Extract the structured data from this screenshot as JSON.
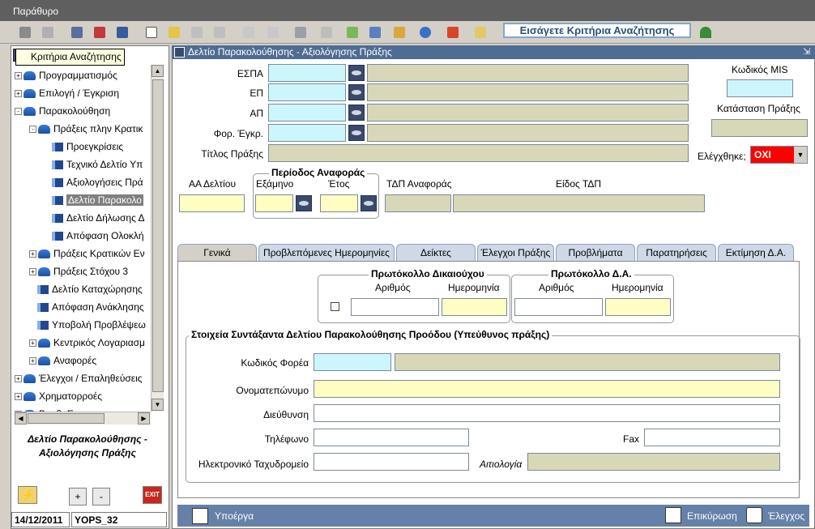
{
  "window": {
    "title": "Παράθυρο"
  },
  "toolbar": {
    "search_hint": "Εισάγετε Κριτήρια Αναζήτησης"
  },
  "left_panel": {
    "tooltip": "Κριτήρια Αναζήτησης",
    "tree": [
      {
        "label": "Προγραμματισμός",
        "level": 0,
        "type": "folder",
        "expander": "+"
      },
      {
        "label": "Επιλογή / Έγκριση",
        "level": 0,
        "type": "folder",
        "expander": "+"
      },
      {
        "label": "Παρακολούθηση",
        "level": 0,
        "type": "folder",
        "expander": "-"
      },
      {
        "label": "Πράξεις πλην Κρατικ",
        "level": 1,
        "type": "folder",
        "expander": "-"
      },
      {
        "label": "Προεγκρίσεις",
        "level": 2,
        "type": "doc"
      },
      {
        "label": "Τεχνικό Δελτίο Υπ",
        "level": 2,
        "type": "doc"
      },
      {
        "label": "Αξιολογήσεις Πρά",
        "level": 2,
        "type": "doc"
      },
      {
        "label": "Δελτίο Παρακολο",
        "level": 2,
        "type": "doc",
        "selected": true
      },
      {
        "label": "Δελτίο Δήλωσης Δ",
        "level": 2,
        "type": "doc"
      },
      {
        "label": "Απόφαση Ολοκλή",
        "level": 2,
        "type": "doc"
      },
      {
        "label": "Πράξεις Κρατικών Εν",
        "level": 1,
        "type": "folder",
        "expander": "+"
      },
      {
        "label": "Πράξεις Στόχου 3",
        "level": 1,
        "type": "folder",
        "expander": "+"
      },
      {
        "label": "Δελτίο Καταχώρησης",
        "level": 1,
        "type": "doc"
      },
      {
        "label": "Απόφαση Ανάκλησης",
        "level": 1,
        "type": "doc"
      },
      {
        "label": "Υποβολή Προβλέψεω",
        "level": 1,
        "type": "doc"
      },
      {
        "label": "Κεντρικός Λογαριασμ",
        "level": 1,
        "type": "folder",
        "expander": "+"
      },
      {
        "label": "Αναφορές",
        "level": 1,
        "type": "folder",
        "expander": "+"
      },
      {
        "label": "Έλεγχοι / Επαληθεύσεις",
        "level": 0,
        "type": "folder",
        "expander": "+"
      },
      {
        "label": "Χρηματορροές",
        "level": 0,
        "type": "folder",
        "expander": "+"
      },
      {
        "label": "Βοηθ. Εφ.",
        "level": 0,
        "type": "folder",
        "expander": "+"
      }
    ],
    "caption_line1": "Δελτίο Παρακολούθησης -",
    "caption_line2": "Αξιολόγησης Πράξης",
    "plus_label": "+",
    "minus_label": "-",
    "exit_label": "EXIT",
    "date": "14/12/2011",
    "user": "YOPS_32"
  },
  "form": {
    "title": "Δελτίο Παρακολούθησης - Αξιολόγησης Πράξης",
    "espa_label": "ΕΣΠΑ",
    "ep_label": "ΕΠ",
    "ap_label": "ΑΠ",
    "foreas_label": "Φορ. Έγκρ.",
    "titlos_label": "Τίτλος Πράξης",
    "mis_label": "Κωδικός MIS",
    "katastasi_label": "Κατάσταση Πράξης",
    "elegxthike_label": "Ελέγχθηκε;",
    "elegxthike_value": "ΟΧΙ",
    "aa_label": "ΑΑ Δελτίου",
    "periodos_label": "Περίοδος Αναφοράς",
    "examino_label": "Εξάμηνο",
    "etos_label": "Έτος",
    "tdp_anaforas_label": "ΤΔΠ Αναφοράς",
    "eidos_tdp_label": "Είδος ΤΔΠ"
  },
  "tabs": [
    "Γενικά",
    "Προβλεπόμενες Ημερομηνίες",
    "Δείκτες",
    "Έλεγχοι Πράξης",
    "Προβλήματα",
    "Παρατηρήσεις",
    "Εκτίμηση Δ.Α."
  ],
  "general_tab": {
    "protokollo_dikaiouxou": "Πρωτόκολλο Δικαιούχου",
    "protokollo_da": "Πρωτόκολλο Δ.Α.",
    "arithmos_label": "Αριθμός",
    "hmerominia_label": "Ημερομηνία",
    "stoixeia_title": "Στοιχεία Συντάξαντα Δελτίου Παρακολούθησης Προόδου (Υπεύθυνος πράξης)",
    "kodikos_forea_label": "Κωδικός Φορέα",
    "onomateponymo_label": "Ονοματεπώνυμο",
    "dieuthinsi_label": "Διεύθυνση",
    "tilefono_label": "Τηλέφωνο",
    "fax_label": "Fax",
    "email_label": "Ηλεκτρονικό Ταχυδρομείο",
    "aitiologia_label": "Αιτιολογία"
  },
  "bottom_bar": {
    "in_progress": "Υπoέργα",
    "validation": "Επικύρωση",
    "check": "Έλεγχος"
  },
  "colors": {
    "required_field": "#fefec3",
    "lov_field": "#ccf6fc",
    "readonly_field": "#d8d8b8",
    "title_bar": "#4f6c93",
    "alert": "#ff0000"
  }
}
